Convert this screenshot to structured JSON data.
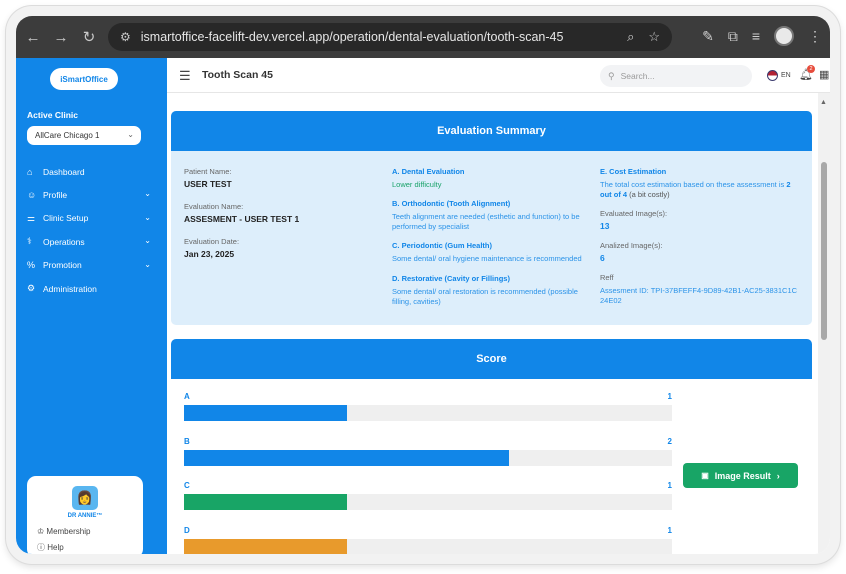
{
  "browser": {
    "url": "ismartoffice-facelift-dev.vercel.app/operation/dental-evaluation/tooth-scan-45"
  },
  "sidebar": {
    "logo_text": "iSmartOffice",
    "active_clinic_label": "Active Clinic",
    "clinic_value": "AllCare Chicago 1",
    "items": [
      {
        "label": "Dashboard",
        "icon": "home-icon",
        "has_chevron": false
      },
      {
        "label": "Profile",
        "icon": "user-icon",
        "has_chevron": true
      },
      {
        "label": "Clinic Setup",
        "icon": "sliders-icon",
        "has_chevron": true
      },
      {
        "label": "Operations",
        "icon": "stethoscope-icon",
        "has_chevron": true
      },
      {
        "label": "Promotion",
        "icon": "percent-icon",
        "has_chevron": true
      },
      {
        "label": "Administration",
        "icon": "gear-icon",
        "has_chevron": false
      }
    ],
    "user": {
      "name": "DR ANNIE™",
      "membership": "Membership",
      "help": "Help"
    }
  },
  "header": {
    "title": "Tooth Scan 45",
    "search_placeholder": "Search...",
    "language": "EN",
    "notification_count": "2"
  },
  "evaluation": {
    "title": "Evaluation Summary",
    "patient_name_label": "Patient Name:",
    "patient_name": "USER TEST",
    "evaluation_name_label": "Evaluation Name:",
    "evaluation_name": "ASSESMENT - USER TEST 1",
    "evaluation_date_label": "Evaluation Date:",
    "evaluation_date": "Jan 23, 2025",
    "sections": [
      {
        "heading": "A. Dental Evaluation",
        "text": "Lower difficulty",
        "color": "#1aa36a"
      },
      {
        "heading": "B. Orthodontic (Tooth Alignment)",
        "text": "Teeth alignment are needed (esthetic and function) to be performed by specialist",
        "color": "#2b93e8"
      },
      {
        "heading": "C. Periodontic (Gum Health)",
        "text": "Some dental/ oral hygiene maintenance is recommended",
        "color": "#2b93e8"
      },
      {
        "heading": "D. Restorative (Cavity or Fillings)",
        "text": "Some dental/ oral restoration is recommended (possible filling, cavities)",
        "color": "#2b93e8"
      }
    ],
    "cost": {
      "heading": "E. Cost Estimation",
      "text_prefix": "The total cost estimation based on these assessment is ",
      "text_bold": "2 out of 4",
      "text_suffix": " (a bit costly)",
      "evaluated_label": "Evaluated Image(s):",
      "evaluated_value": "13",
      "analized_label": "Analized Image(s):",
      "analized_value": "6",
      "reff_label": "Reff",
      "assessment_id": "Assesment ID: TPI-37BFEFF4-9D89-42B1-AC25-3831C1C24E02"
    }
  },
  "score": {
    "title": "Score",
    "max": 3,
    "rows": [
      {
        "label": "A",
        "value": 1,
        "color": "#1186e8"
      },
      {
        "label": "B",
        "value": 2,
        "color": "#1186e8"
      },
      {
        "label": "C",
        "value": 1,
        "color": "#18a566"
      },
      {
        "label": "D",
        "value": 1,
        "color": "#e89a2c"
      }
    ],
    "button_label": "Image Result"
  }
}
